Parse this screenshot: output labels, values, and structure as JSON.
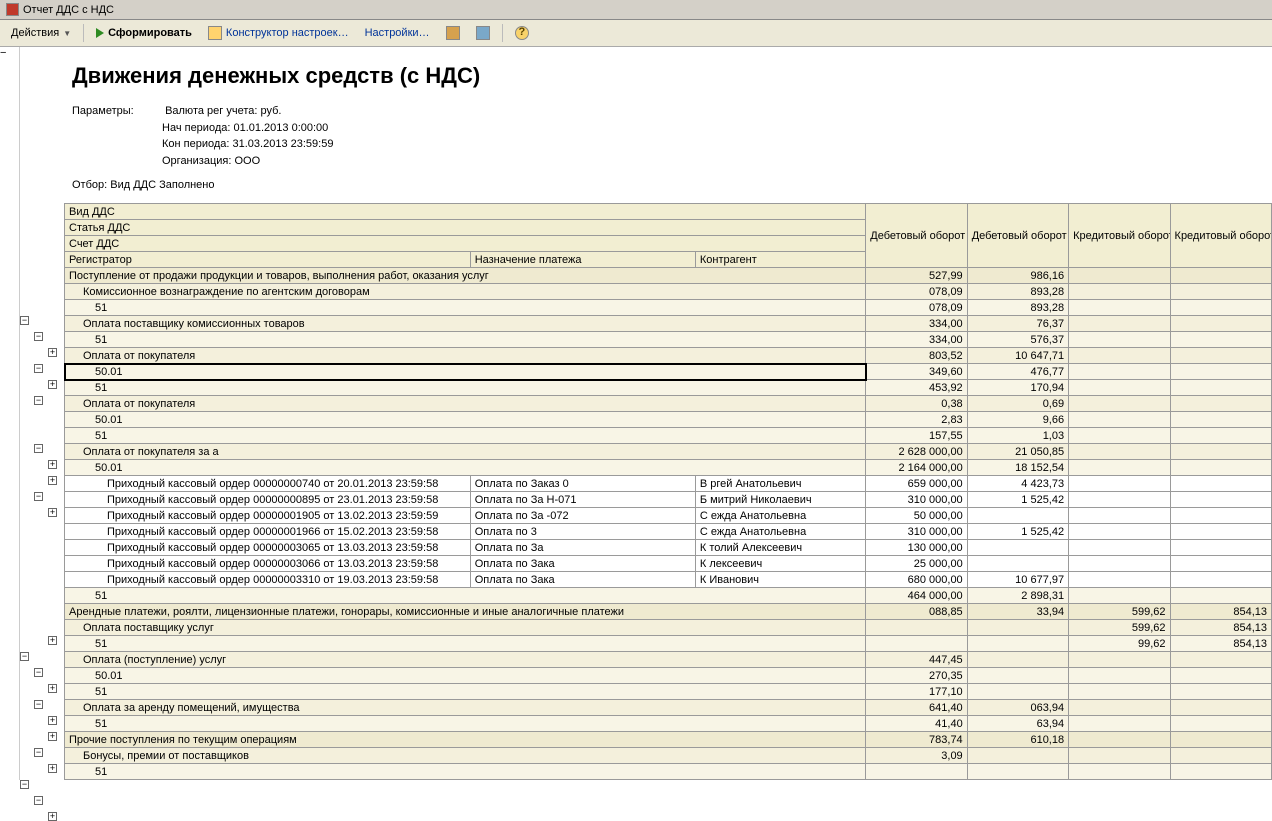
{
  "title": "Отчет  ДДС с НДС",
  "toolbar": {
    "actions": "Действия",
    "form": "Сформировать",
    "constructor": "Конструктор настроек…",
    "settings": "Настройки…"
  },
  "report": {
    "heading": "Движения денежных средств (с НДС)",
    "params_label": "Параметры:",
    "p1": "Валюта рег учета: руб.",
    "p2": "Нач периода: 01.01.2013 0:00:00",
    "p3": "Кон периода: 31.03.2013 23:59:59",
    "p4": "Организация: ООО",
    "filter": "Отбор: Вид ДДС Заполнено"
  },
  "header": {
    "h1": "Вид ДДС",
    "h2": "Статья ДДС",
    "h3": "Счет ДДС",
    "h4": "Регистратор",
    "h5": "Назначение платежа",
    "h6": "Контрагент",
    "c1": "Дебетовый оборот",
    "c2": "Дебетовый оборот (НДС)",
    "c3": "Кредитовый оборот",
    "c4": "Кредитовый оборот (НДС)"
  },
  "rows": [
    {
      "cls": "lvl0",
      "desc": "Поступление от продажи продукции и товаров, выполнения работ, оказания услуг",
      "span": 3,
      "v": [
        "527,99",
        "986,16",
        "",
        ""
      ]
    },
    {
      "cls": "lvl1",
      "desc": "Комиссионное вознаграждение по агентским договорам",
      "pad": "p1",
      "span": 3,
      "v": [
        "078,09",
        "893,28",
        "",
        ""
      ]
    },
    {
      "cls": "lvl2",
      "desc": "51",
      "pad": "p2",
      "span": 3,
      "v": [
        "078,09",
        "893,28",
        "",
        ""
      ]
    },
    {
      "cls": "lvl1",
      "desc": "Оплата поставщику комиссионных товаров",
      "pad": "p1",
      "span": 3,
      "v": [
        "334,00",
        "76,37",
        "",
        ""
      ]
    },
    {
      "cls": "lvl2",
      "desc": "51",
      "pad": "p2",
      "span": 3,
      "v": [
        "334,00",
        "576,37",
        "",
        ""
      ]
    },
    {
      "cls": "lvl1",
      "desc": "Оплата от покупателя",
      "pad": "p1",
      "span": 3,
      "v": [
        "803,52",
        "10 647,71",
        "",
        ""
      ]
    },
    {
      "cls": "lvl2 sel",
      "desc": "50.01",
      "pad": "p2",
      "span": 3,
      "v": [
        "349,60",
        "476,77",
        "",
        ""
      ]
    },
    {
      "cls": "lvl2",
      "desc": "51",
      "pad": "p2",
      "span": 3,
      "v": [
        "453,92",
        "170,94",
        "",
        ""
      ]
    },
    {
      "cls": "lvl1",
      "desc": "Оплата от покупателя",
      "pad": "p1",
      "span": 3,
      "v": [
        "0,38",
        "0,69",
        "",
        ""
      ]
    },
    {
      "cls": "lvl2",
      "desc": "50.01",
      "pad": "p2",
      "span": 3,
      "v": [
        "2,83",
        "9,66",
        "",
        ""
      ]
    },
    {
      "cls": "lvl2",
      "desc": "51",
      "pad": "p2",
      "span": 3,
      "v": [
        "157,55",
        "1,03",
        "",
        ""
      ]
    },
    {
      "cls": "lvl1",
      "desc": "Оплата от покупателя за а",
      "pad": "p1",
      "span": 3,
      "v": [
        "2 628 000,00",
        "21 050,85",
        "",
        ""
      ]
    },
    {
      "cls": "lvl2",
      "desc": "50.01",
      "pad": "p2",
      "span": 3,
      "v": [
        "2 164 000,00",
        "18 152,54",
        "",
        ""
      ]
    },
    {
      "cls": "lvl4",
      "desc": "Приходный кассовый ордер 00000000740 от 20.01.2013 23:59:58",
      "pad": "p3",
      "pay": "Оплата по Заказ                     0",
      "ctr": "В         ргей Анатольевич",
      "v": [
        "659 000,00",
        "4 423,73",
        "",
        ""
      ]
    },
    {
      "cls": "lvl4",
      "desc": "Приходный кассовый ордер 00000000895 от 23.01.2013 23:59:58",
      "pad": "p3",
      "pay": "Оплата по За              Н-071",
      "ctr": "Б         митрий Николаевич",
      "v": [
        "310 000,00",
        "1 525,42",
        "",
        ""
      ]
    },
    {
      "cls": "lvl4",
      "desc": "Приходный кассовый ордер 00000001905 от 13.02.2013 23:59:59",
      "pad": "p3",
      "pay": "Оплата по За               -072",
      "ctr": "С         ежда Анатольевна",
      "v": [
        "50 000,00",
        "",
        "",
        ""
      ]
    },
    {
      "cls": "lvl4",
      "desc": "Приходный кассовый ордер 00000001966 от 15.02.2013 23:59:58",
      "pad": "p3",
      "pay": "Оплата по 3",
      "ctr": "С    ежда Анатольевна",
      "v": [
        "310 000,00",
        "1 525,42",
        "",
        ""
      ]
    },
    {
      "cls": "lvl4",
      "desc": "Приходный кассовый ордер 00000003065 от 13.03.2013 23:59:58",
      "pad": "p3",
      "pay": "Оплата по За",
      "ctr": "К         толий Алексеевич",
      "v": [
        "130 000,00",
        "",
        "",
        ""
      ]
    },
    {
      "cls": "lvl4",
      "desc": "Приходный кассовый ордер 00000003066 от 13.03.2013 23:59:58",
      "pad": "p3",
      "pay": "Оплата по Зака",
      "ctr": "К              лексеевич",
      "v": [
        "25 000,00",
        "",
        "",
        ""
      ]
    },
    {
      "cls": "lvl4",
      "desc": "Приходный кассовый ордер 00000003310 от 19.03.2013 23:59:58",
      "pad": "p3",
      "pay": "Оплата по Зака",
      "ctr": "К              Иванович",
      "v": [
        "680 000,00",
        "10 677,97",
        "",
        ""
      ]
    },
    {
      "cls": "lvl2",
      "desc": "51",
      "pad": "p2",
      "span": 3,
      "v": [
        "464 000,00",
        "2 898,31",
        "",
        ""
      ]
    },
    {
      "cls": "lvl0",
      "desc": "Арендные платежи, роялти, лицензионные платежи, гонорары, комиссионные и иные аналогичные платежи",
      "span": 3,
      "v": [
        "088,85",
        "33,94",
        "599,62",
        "854,13"
      ]
    },
    {
      "cls": "lvl1",
      "desc": "Оплата поставщику услуг",
      "pad": "p1",
      "span": 3,
      "v": [
        "",
        "",
        "599,62",
        "854,13"
      ]
    },
    {
      "cls": "lvl2",
      "desc": "51",
      "pad": "p2",
      "span": 3,
      "v": [
        "",
        "",
        "99,62",
        "854,13"
      ]
    },
    {
      "cls": "lvl1",
      "desc": "Оплата (поступление) услуг",
      "pad": "p1",
      "span": 3,
      "v": [
        "447,45",
        "",
        "",
        ""
      ]
    },
    {
      "cls": "lvl2",
      "desc": "50.01",
      "pad": "p2",
      "span": 3,
      "v": [
        "270,35",
        "",
        "",
        ""
      ]
    },
    {
      "cls": "lvl2",
      "desc": "51",
      "pad": "p2",
      "span": 3,
      "v": [
        "177,10",
        "",
        "",
        ""
      ]
    },
    {
      "cls": "lvl1",
      "desc": "Оплата за аренду помещений, имущества",
      "pad": "p1",
      "span": 3,
      "v": [
        "641,40",
        "063,94",
        "",
        ""
      ]
    },
    {
      "cls": "lvl2",
      "desc": "51",
      "pad": "p2",
      "span": 3,
      "v": [
        "41,40",
        "63,94",
        "",
        ""
      ]
    },
    {
      "cls": "lvl0",
      "desc": "Прочие поступления по текущим операциям",
      "span": 3,
      "v": [
        "783,74",
        "610,18",
        "",
        ""
      ]
    },
    {
      "cls": "lvl1",
      "desc": "Бонусы, премии от поставщиков",
      "pad": "p1",
      "span": 3,
      "v": [
        "3,09",
        "",
        "",
        ""
      ]
    },
    {
      "cls": "lvl2",
      "desc": "51",
      "pad": "p2",
      "span": 3,
      "v": [
        "",
        "",
        "",
        ""
      ]
    }
  ]
}
